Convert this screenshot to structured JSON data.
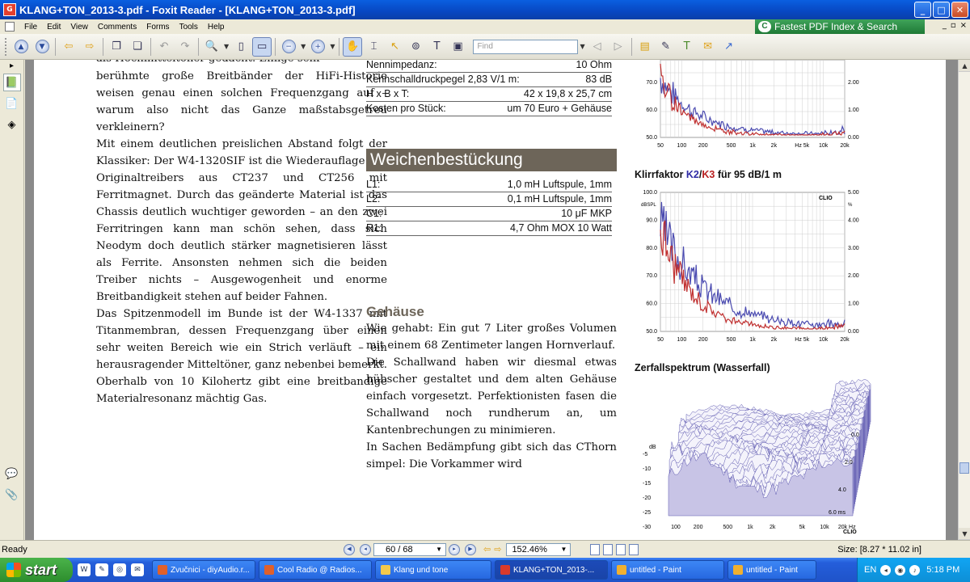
{
  "window": {
    "title": "KLANG+TON_2013-3.pdf - Foxit Reader - [KLANG+TON_2013-3.pdf]",
    "icon": "foxit-app-icon",
    "controls": [
      "_",
      "□",
      "✕"
    ]
  },
  "menu": {
    "items": [
      "File",
      "Edit",
      "View",
      "Comments",
      "Forms",
      "Tools",
      "Help"
    ],
    "mdi_controls": [
      "_",
      "▫",
      "×"
    ]
  },
  "ad_banner": {
    "text": "Fastest PDF Index & Search"
  },
  "toolbar": {
    "find_placeholder": "Find",
    "icons": [
      "arrow-up-circle-icon",
      "arrow-down-circle-icon",
      "back-arrow-icon",
      "forward-arrow-icon",
      "copy-pages-icon",
      "paste-pages-icon",
      "undo-icon",
      "redo-icon",
      "zoom-in-icon",
      "fit-page-icon",
      "fit-width-icon",
      "zoom-out-circle-icon",
      "zoom-in-circle-icon",
      "hand-tool-icon",
      "select-text-icon",
      "select-pointer-icon",
      "binoculars-icon",
      "typewriter-icon",
      "snapshot-icon",
      "search-prev-icon",
      "search-next-icon",
      "folder-icon",
      "pen-icon",
      "text-tool-icon",
      "note-icon",
      "arrow-tool-icon"
    ]
  },
  "document": {
    "col1_clipped_top": "als Hochmitteltöner gedacht. Einige sehr",
    "col1_paragraphs": [
      "berühmte große Breitbänder der HiFi-Historie weisen genau einen solchen Frequenzgang auf – warum also nicht das Ganze maßstabsgetreu verkleinern?",
      "Mit einem deutlichen preislichen Abstand folgt der Klassiker: Der W4-1320SIF ist die Wiederauflage des Originaltreibers aus CT237 und CT256 mit Ferritmagnet. Durch das geänderte Material ist das Chassis deutlich wuchtiger geworden – an den zwei Ferritringen kann man schön sehen, dass sich Neodym doch deutlich stärker magnetisieren lässt als Ferrite. Ansonsten nehmen sich die beiden Treiber nichts – Ausgewogenheit und enorme Breitbandigkeit stehen auf beider Fahnen.",
      "Das Spitzenmodell im Bunde ist der W4-1337 mit Titanmembran, dessen Frequenzgang über einen sehr weiten Bereich wie ein Strich verläuft – ein herausragender Mitteltöner, ganz nebenbei bemerkt. Oberhalb von 10 Kilohertz gibt eine breitbandige Materialresonanz mächtig Gas."
    ],
    "spec_rows": [
      {
        "label": "Nennimpedanz:",
        "value": "10 Ohm"
      },
      {
        "label": "Kennschalldruckpegel 2,83 V/1 m:",
        "value": "83 dB"
      },
      {
        "label": "H x B x T:",
        "value": "42 x 19,8 x 25,7 cm"
      },
      {
        "label": "Kosten pro Stück:",
        "value": "um 70 Euro + Gehäuse"
      }
    ],
    "weichen_heading": "Weichenbestückung",
    "weichen_rows": [
      {
        "label": "L1:",
        "value": "1,0 mH Luftspule, 1mm"
      },
      {
        "label": "L2:",
        "value": "0,1 mH Luftspule, 1mm"
      },
      {
        "label": "C1:",
        "value": "10 μF MKP"
      },
      {
        "label": "R1:",
        "value": "4,7 Ohm MOX 10 Watt"
      }
    ],
    "gehaeuse_heading": "Gehäuse",
    "gehaeuse_paragraphs": [
      "Wie gehabt: Ein gut 7 Liter großes Volumen mit einem 68 Zentimeter langen Hornverlauf.",
      "Die Schallwand haben wir diesmal etwas hübscher gestaltet und dem alten Gehäuse einfach vorgesetzt. Perfektionisten fasen die Schallwand noch rundherum an, um Kantenbrechungen zu minimieren.",
      "In Sachen Bedämpfung gibt sich das CThorn simpel: Die Vorkammer wird"
    ],
    "chart1": {
      "left_ticks": [
        "70.0",
        "60.0",
        "50.0"
      ],
      "right_ticks": [
        "2.00",
        "1.00",
        "0.00"
      ],
      "x_ticks": [
        "50",
        "100",
        "200",
        "500",
        "1k",
        "2k",
        "Hz 5k",
        "10k",
        "20k"
      ]
    },
    "chart2_title_prefix": "Klirrfaktor ",
    "chart2_title_k2": "K2",
    "chart2_title_slash": "/",
    "chart2_title_k3": "K3",
    "chart2_title_suffix": " für 95 dB/1 m",
    "chart2": {
      "brand": "CLIO",
      "left_unit": "dBSPL",
      "right_unit": "%",
      "left_ticks": [
        "100.0",
        "90.0",
        "80.0",
        "70.0",
        "60.0",
        "50.0"
      ],
      "right_ticks": [
        "5.00",
        "4.00",
        "3.00",
        "2.00",
        "1.00",
        "0.00"
      ],
      "x_ticks": [
        "50",
        "100",
        "200",
        "500",
        "1k",
        "2k",
        "Hz 5k",
        "10k",
        "20k"
      ]
    },
    "chart3_title": "Zerfallspektrum (Wasserfall)",
    "chart3": {
      "brand": "CLIO",
      "db_unit": "dB",
      "z_ticks": [
        "-5",
        "-10",
        "-15",
        "-20",
        "-25",
        "-30"
      ],
      "t_ticks": [
        "0.0",
        "2.0",
        "4.0",
        "6.0 ms"
      ],
      "x_ticks": [
        "100",
        "200",
        "500",
        "1k",
        "2k",
        "5k",
        "10k",
        "20k Hz"
      ]
    }
  },
  "statusbar": {
    "ready": "Ready",
    "page_value": "60 / 68",
    "zoom_value": "152.46%",
    "size": "Size: [8.27 * 11.02 in]"
  },
  "taskbar": {
    "start": "start",
    "tasks": [
      {
        "label": "Zvučnici - diyAudio.r...",
        "color": "#e0602a"
      },
      {
        "label": "Cool Radio @ Radios...",
        "color": "#e0602a"
      },
      {
        "label": "Klang und tone",
        "color": "#f2c94c"
      },
      {
        "label": "KLANG+TON_2013-...",
        "color": "#d93a2b",
        "active": true
      },
      {
        "label": "untitled - Paint",
        "color": "#f0b030"
      },
      {
        "label": "untitled - Paint",
        "color": "#f0b030"
      }
    ],
    "lang": "EN",
    "time": "5:18 PM"
  }
}
